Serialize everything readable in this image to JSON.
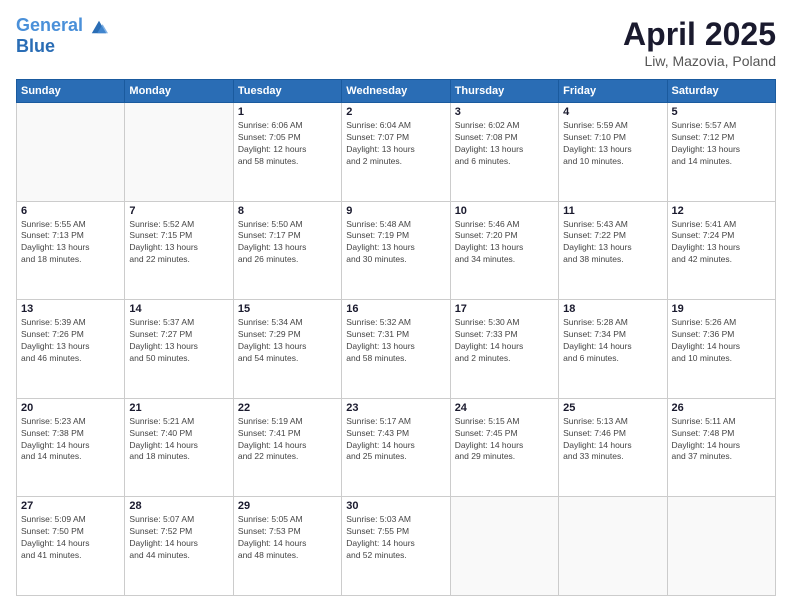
{
  "header": {
    "logo_line1": "General",
    "logo_line2": "Blue",
    "main_title": "April 2025",
    "subtitle": "Liw, Mazovia, Poland"
  },
  "days_of_week": [
    "Sunday",
    "Monday",
    "Tuesday",
    "Wednesday",
    "Thursday",
    "Friday",
    "Saturday"
  ],
  "weeks": [
    [
      {
        "day": "",
        "info": ""
      },
      {
        "day": "",
        "info": ""
      },
      {
        "day": "1",
        "info": "Sunrise: 6:06 AM\nSunset: 7:05 PM\nDaylight: 12 hours\nand 58 minutes."
      },
      {
        "day": "2",
        "info": "Sunrise: 6:04 AM\nSunset: 7:07 PM\nDaylight: 13 hours\nand 2 minutes."
      },
      {
        "day": "3",
        "info": "Sunrise: 6:02 AM\nSunset: 7:08 PM\nDaylight: 13 hours\nand 6 minutes."
      },
      {
        "day": "4",
        "info": "Sunrise: 5:59 AM\nSunset: 7:10 PM\nDaylight: 13 hours\nand 10 minutes."
      },
      {
        "day": "5",
        "info": "Sunrise: 5:57 AM\nSunset: 7:12 PM\nDaylight: 13 hours\nand 14 minutes."
      }
    ],
    [
      {
        "day": "6",
        "info": "Sunrise: 5:55 AM\nSunset: 7:13 PM\nDaylight: 13 hours\nand 18 minutes."
      },
      {
        "day": "7",
        "info": "Sunrise: 5:52 AM\nSunset: 7:15 PM\nDaylight: 13 hours\nand 22 minutes."
      },
      {
        "day": "8",
        "info": "Sunrise: 5:50 AM\nSunset: 7:17 PM\nDaylight: 13 hours\nand 26 minutes."
      },
      {
        "day": "9",
        "info": "Sunrise: 5:48 AM\nSunset: 7:19 PM\nDaylight: 13 hours\nand 30 minutes."
      },
      {
        "day": "10",
        "info": "Sunrise: 5:46 AM\nSunset: 7:20 PM\nDaylight: 13 hours\nand 34 minutes."
      },
      {
        "day": "11",
        "info": "Sunrise: 5:43 AM\nSunset: 7:22 PM\nDaylight: 13 hours\nand 38 minutes."
      },
      {
        "day": "12",
        "info": "Sunrise: 5:41 AM\nSunset: 7:24 PM\nDaylight: 13 hours\nand 42 minutes."
      }
    ],
    [
      {
        "day": "13",
        "info": "Sunrise: 5:39 AM\nSunset: 7:26 PM\nDaylight: 13 hours\nand 46 minutes."
      },
      {
        "day": "14",
        "info": "Sunrise: 5:37 AM\nSunset: 7:27 PM\nDaylight: 13 hours\nand 50 minutes."
      },
      {
        "day": "15",
        "info": "Sunrise: 5:34 AM\nSunset: 7:29 PM\nDaylight: 13 hours\nand 54 minutes."
      },
      {
        "day": "16",
        "info": "Sunrise: 5:32 AM\nSunset: 7:31 PM\nDaylight: 13 hours\nand 58 minutes."
      },
      {
        "day": "17",
        "info": "Sunrise: 5:30 AM\nSunset: 7:33 PM\nDaylight: 14 hours\nand 2 minutes."
      },
      {
        "day": "18",
        "info": "Sunrise: 5:28 AM\nSunset: 7:34 PM\nDaylight: 14 hours\nand 6 minutes."
      },
      {
        "day": "19",
        "info": "Sunrise: 5:26 AM\nSunset: 7:36 PM\nDaylight: 14 hours\nand 10 minutes."
      }
    ],
    [
      {
        "day": "20",
        "info": "Sunrise: 5:23 AM\nSunset: 7:38 PM\nDaylight: 14 hours\nand 14 minutes."
      },
      {
        "day": "21",
        "info": "Sunrise: 5:21 AM\nSunset: 7:40 PM\nDaylight: 14 hours\nand 18 minutes."
      },
      {
        "day": "22",
        "info": "Sunrise: 5:19 AM\nSunset: 7:41 PM\nDaylight: 14 hours\nand 22 minutes."
      },
      {
        "day": "23",
        "info": "Sunrise: 5:17 AM\nSunset: 7:43 PM\nDaylight: 14 hours\nand 25 minutes."
      },
      {
        "day": "24",
        "info": "Sunrise: 5:15 AM\nSunset: 7:45 PM\nDaylight: 14 hours\nand 29 minutes."
      },
      {
        "day": "25",
        "info": "Sunrise: 5:13 AM\nSunset: 7:46 PM\nDaylight: 14 hours\nand 33 minutes."
      },
      {
        "day": "26",
        "info": "Sunrise: 5:11 AM\nSunset: 7:48 PM\nDaylight: 14 hours\nand 37 minutes."
      }
    ],
    [
      {
        "day": "27",
        "info": "Sunrise: 5:09 AM\nSunset: 7:50 PM\nDaylight: 14 hours\nand 41 minutes."
      },
      {
        "day": "28",
        "info": "Sunrise: 5:07 AM\nSunset: 7:52 PM\nDaylight: 14 hours\nand 44 minutes."
      },
      {
        "day": "29",
        "info": "Sunrise: 5:05 AM\nSunset: 7:53 PM\nDaylight: 14 hours\nand 48 minutes."
      },
      {
        "day": "30",
        "info": "Sunrise: 5:03 AM\nSunset: 7:55 PM\nDaylight: 14 hours\nand 52 minutes."
      },
      {
        "day": "",
        "info": ""
      },
      {
        "day": "",
        "info": ""
      },
      {
        "day": "",
        "info": ""
      }
    ]
  ]
}
